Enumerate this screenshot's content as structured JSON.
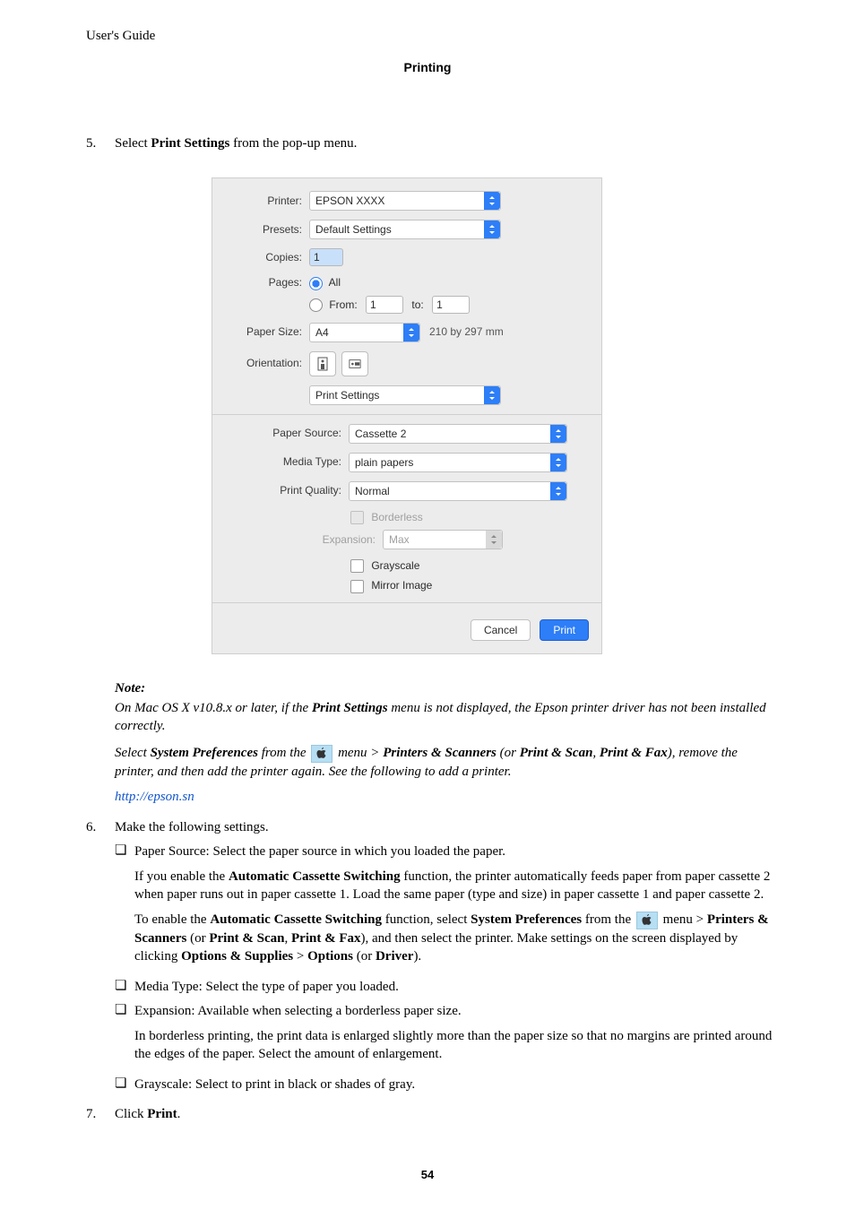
{
  "doc": {
    "header": "User's Guide",
    "section": "Printing",
    "page_number": "54"
  },
  "step5": {
    "num": "5.",
    "text_a": "Select ",
    "text_b_bold": "Print Settings",
    "text_c": " from the pop-up menu."
  },
  "dialog": {
    "printer_label": "Printer:",
    "printer_value": "EPSON XXXX",
    "presets_label": "Presets:",
    "presets_value": "Default Settings",
    "copies_label": "Copies:",
    "copies_value": "1",
    "pages_label": "Pages:",
    "pages_all": "All",
    "pages_from_label": "From:",
    "pages_from_value": "1",
    "pages_to_label": "to:",
    "pages_to_value": "1",
    "paper_size_label": "Paper Size:",
    "paper_size_value": "A4",
    "paper_size_dims": "210 by 297 mm",
    "orientation_label": "Orientation:",
    "section_menu": "Print Settings",
    "paper_source_label": "Paper Source:",
    "paper_source_value": "Cassette 2",
    "media_type_label": "Media Type:",
    "media_type_value": "plain papers",
    "print_quality_label": "Print Quality:",
    "print_quality_value": "Normal",
    "borderless_label": "Borderless",
    "expansion_label": "Expansion:",
    "expansion_value": "Max",
    "grayscale_label": "Grayscale",
    "mirror_label": "Mirror Image",
    "cancel": "Cancel",
    "print": "Print"
  },
  "note": {
    "heading": "Note:",
    "line1_a": "On Mac OS X v10.8.x or later, if the ",
    "line1_b": "Print Settings",
    "line1_c": " menu is not displayed, the Epson printer driver has not been installed correctly.",
    "line2_a": "Select ",
    "line2_b": "System Preferences",
    "line2_c": " from the ",
    "line2_d": " menu > ",
    "line2_e": "Printers & Scanners",
    "line2_f": " (or ",
    "line2_g": "Print & Scan",
    "line2_h": ", ",
    "line2_i": "Print & Fax",
    "line2_j": "), remove the printer, and then add the printer again. See the following to add a printer.",
    "link": "http://epson.sn"
  },
  "step6": {
    "num": "6.",
    "text": "Make the following settings."
  },
  "bullets": {
    "b1": "Paper Source: Select the paper source in which you loaded the paper.",
    "b1_sub1_a": "If you enable the ",
    "b1_sub1_b": "Automatic Cassette Switching",
    "b1_sub1_c": " function, the printer automatically feeds paper from paper cassette 2 when paper runs out in paper cassette 1. Load the same paper (type and size) in paper cassette 1 and paper cassette 2.",
    "b1_sub2_a": "To enable the ",
    "b1_sub2_b": "Automatic Cassette Switching",
    "b1_sub2_c": " function, select ",
    "b1_sub2_d": "System Preferences",
    "b1_sub2_e": " from the ",
    "b1_sub2_f": " menu > ",
    "b1_sub2_g": "Printers & Scanners",
    "b1_sub2_h": " (or ",
    "b1_sub2_i": "Print & Scan",
    "b1_sub2_j": ", ",
    "b1_sub2_k": "Print & Fax",
    "b1_sub2_l": "), and then select the printer. Make settings on the screen displayed by clicking ",
    "b1_sub2_m": "Options & Supplies",
    "b1_sub2_n": " > ",
    "b1_sub2_o": "Options",
    "b1_sub2_p": " (or ",
    "b1_sub2_q": "Driver",
    "b1_sub2_r": ").",
    "b2": "Media Type: Select the type of paper you loaded.",
    "b3": "Expansion: Available when selecting a borderless paper size.",
    "b3_sub": "In borderless printing, the print data is enlarged slightly more than the paper size so that no margins are printed around the edges of the paper. Select the amount of enlargement.",
    "b4": "Grayscale: Select to print in black or shades of gray."
  },
  "step7": {
    "num": "7.",
    "text_a": "Click ",
    "text_b": "Print",
    "text_c": "."
  }
}
